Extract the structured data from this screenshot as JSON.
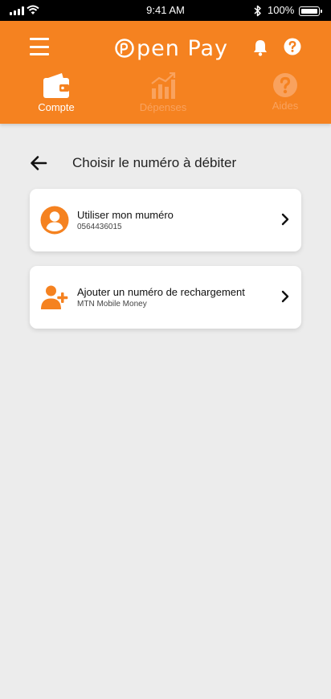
{
  "status_bar": {
    "time": "9:41 AM",
    "battery": "100%"
  },
  "header": {
    "logo_text": "pen Pay",
    "tabs": [
      {
        "label": "Compte",
        "icon": "wallet-icon",
        "active": true
      },
      {
        "label": "Dépenses",
        "icon": "chart-icon",
        "active": false
      },
      {
        "label": "Aides",
        "icon": "help-circle-icon",
        "active": false
      }
    ]
  },
  "page": {
    "title": "Choisir le numéro à débiter"
  },
  "options": [
    {
      "title": "Utiliser mon muméro",
      "subtitle": "0564436015",
      "icon": "user-circle-icon"
    },
    {
      "title": "Ajouter un numéro de rechargement",
      "subtitle": "MTN Mobile Money",
      "icon": "add-user-icon"
    }
  ],
  "colors": {
    "brand": "#f58220",
    "inactive_tab": "#f9a25e",
    "background": "#ececec"
  }
}
